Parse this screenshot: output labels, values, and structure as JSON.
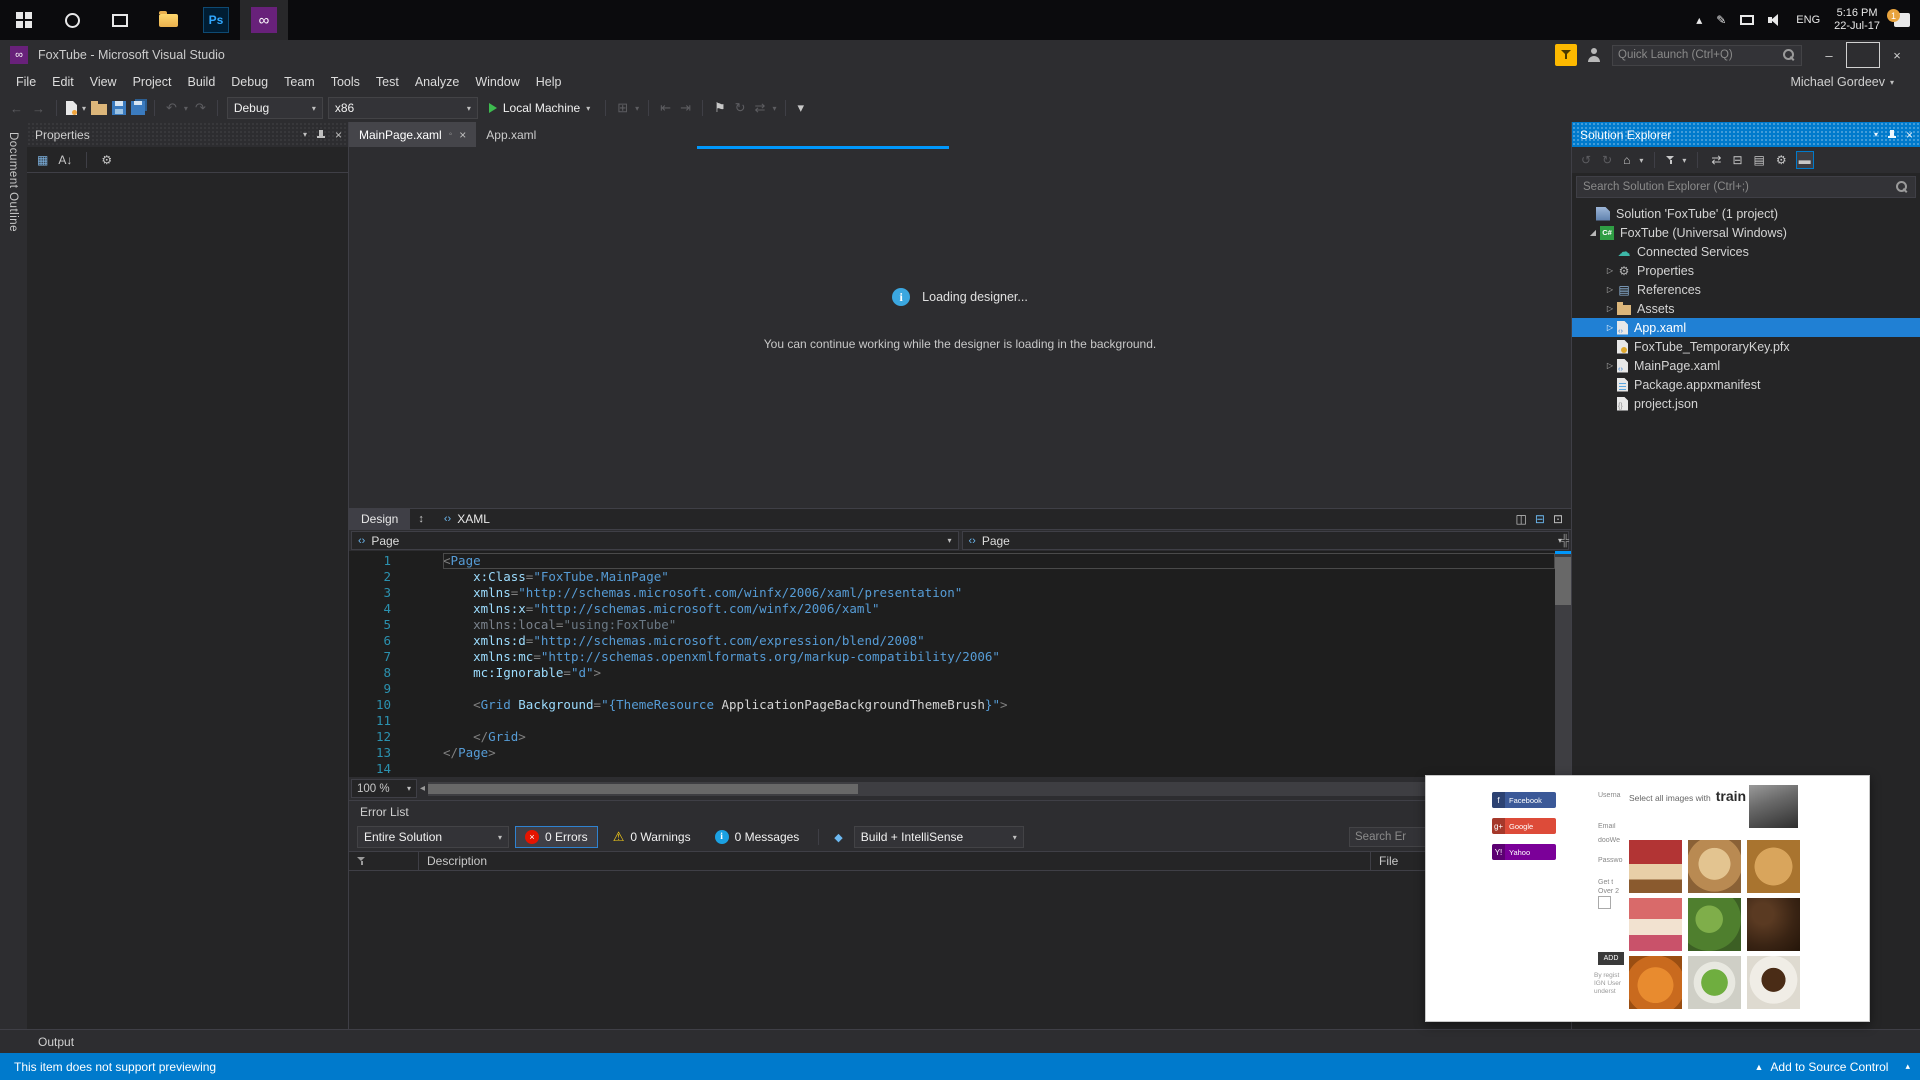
{
  "taskbar": {
    "tray": {
      "lang": "ENG",
      "time": "5:16 PM",
      "date": "22-Jul-17",
      "badge": "1"
    }
  },
  "titlebar": {
    "title": "FoxTube - Microsoft Visual Studio",
    "quick_launch_placeholder": "Quick Launch (Ctrl+Q)"
  },
  "menus": [
    "File",
    "Edit",
    "View",
    "Project",
    "Build",
    "Debug",
    "Team",
    "Tools",
    "Test",
    "Analyze",
    "Window",
    "Help"
  ],
  "account_name": "Michael Gordeev",
  "toolbar": {
    "configuration": "Debug",
    "platform": "x86",
    "run_target": "Local Machine"
  },
  "left_panel": {
    "autohide_tab": "Document Outline",
    "title": "Properties"
  },
  "editor": {
    "tabs": [
      {
        "label": "MainPage.xaml"
      },
      {
        "label": "App.xaml"
      }
    ],
    "designer_loading_title": "Loading designer...",
    "designer_loading_hint": "You can continue working while the designer is loading in the background.",
    "design_tab": "Design",
    "xaml_tab": "XAML",
    "breadcrumb_left": "Page",
    "breadcrumb_right": "Page",
    "zoom": "100 %",
    "code_lines": [
      [
        [
          "br",
          "<"
        ],
        [
          "tag",
          "Page"
        ]
      ],
      [
        [
          "pl",
          "    "
        ],
        [
          "att",
          "x:Class"
        ],
        [
          "br",
          "="
        ],
        [
          "val",
          "\"FoxTube.MainPage\""
        ]
      ],
      [
        [
          "pl",
          "    "
        ],
        [
          "att",
          "xmlns"
        ],
        [
          "br",
          "="
        ],
        [
          "val",
          "\"http://schemas.microsoft.com/winfx/2006/xaml/presentation\""
        ]
      ],
      [
        [
          "pl",
          "    "
        ],
        [
          "att",
          "xmlns:x"
        ],
        [
          "br",
          "="
        ],
        [
          "val",
          "\"http://schemas.microsoft.com/winfx/2006/xaml\""
        ]
      ],
      [
        [
          "pl",
          "    "
        ],
        [
          "dim",
          "xmlns:local"
        ],
        [
          "br",
          "="
        ],
        [
          "dmv",
          "\"using:FoxTube\""
        ]
      ],
      [
        [
          "pl",
          "    "
        ],
        [
          "att",
          "xmlns:d"
        ],
        [
          "br",
          "="
        ],
        [
          "val",
          "\"http://schemas.microsoft.com/expression/blend/2008\""
        ]
      ],
      [
        [
          "pl",
          "    "
        ],
        [
          "att",
          "xmlns:mc"
        ],
        [
          "br",
          "="
        ],
        [
          "val",
          "\"http://schemas.openxmlformats.org/markup-compatibility/2006\""
        ]
      ],
      [
        [
          "pl",
          "    "
        ],
        [
          "att",
          "mc:Ignorable"
        ],
        [
          "br",
          "="
        ],
        [
          "val",
          "\"d\""
        ],
        [
          "br",
          ">"
        ]
      ],
      [],
      [
        [
          "pl",
          "    "
        ],
        [
          "br",
          "<"
        ],
        [
          "tag",
          "Grid"
        ],
        [
          "pl",
          " "
        ],
        [
          "att",
          "Background"
        ],
        [
          "br",
          "="
        ],
        [
          "val",
          "\"{"
        ],
        [
          "tag",
          "ThemeResource"
        ],
        [
          "res",
          " ApplicationPageBackgroundThemeBrush"
        ],
        [
          "val",
          "}\""
        ],
        [
          "br",
          ">"
        ]
      ],
      [],
      [
        [
          "pl",
          "    "
        ],
        [
          "br",
          "</"
        ],
        [
          "tag",
          "Grid"
        ],
        [
          "br",
          ">"
        ]
      ],
      [
        [
          "br",
          "</"
        ],
        [
          "tag",
          "Page"
        ],
        [
          "br",
          ">"
        ]
      ],
      []
    ]
  },
  "error_list": {
    "title": "Error List",
    "scope": "Entire Solution",
    "errors_label": "0 Errors",
    "warnings_label": "0 Warnings",
    "messages_label": "0 Messages",
    "filter_label": "Build + IntelliSense",
    "search_placeholder": "Search Er",
    "columns": {
      "description": "Description",
      "file": "File"
    }
  },
  "output": {
    "title": "Output"
  },
  "statusbar": {
    "message": "This item does not support previewing",
    "source_control": "Add to Source Control"
  },
  "solution_explorer": {
    "title": "Solution Explorer",
    "search_placeholder": "Search Solution Explorer (Ctrl+;)",
    "items": [
      {
        "label": "Solution 'FoxTube' (1 project)",
        "icon": "solution",
        "indent": 0,
        "expander": ""
      },
      {
        "label": "FoxTube (Universal Windows)",
        "icon": "csproj",
        "indent": 1,
        "expander": "expanded"
      },
      {
        "label": "Connected Services",
        "icon": "services",
        "indent": 2,
        "expander": ""
      },
      {
        "label": "Properties",
        "icon": "properties",
        "indent": 2,
        "expander": "collapsed"
      },
      {
        "label": "References",
        "icon": "references",
        "indent": 2,
        "expander": "collapsed"
      },
      {
        "label": "Assets",
        "icon": "folder",
        "indent": 2,
        "expander": "collapsed"
      },
      {
        "label": "App.xaml",
        "icon": "xaml",
        "indent": 2,
        "expander": "collapsed",
        "selected": true
      },
      {
        "label": "FoxTube_TemporaryKey.pfx",
        "icon": "cert",
        "indent": 2,
        "expander": ""
      },
      {
        "label": "MainPage.xaml",
        "icon": "xaml",
        "indent": 2,
        "expander": "collapsed"
      },
      {
        "label": "Package.appxmanifest",
        "icon": "manifest",
        "indent": 2,
        "expander": ""
      },
      {
        "label": "project.json",
        "icon": "json",
        "indent": 2,
        "expander": ""
      }
    ]
  },
  "overlay": {
    "social_buttons": [
      {
        "name": "facebook",
        "label": "Facebook",
        "abbr": "f",
        "color": "#3b5998"
      },
      {
        "name": "google",
        "label": "Google",
        "abbr": "g+",
        "color": "#dd4b39"
      },
      {
        "name": "yahoo",
        "label": "Yahoo",
        "abbr": "Y!",
        "color": "#7b0099"
      }
    ],
    "form_fragments": [
      "Userna",
      "Email",
      "dooWe",
      "Passwo",
      "Get t",
      "Over 2"
    ],
    "add_button": "ADD",
    "fine_print": "By regist IGN User underst",
    "captcha": {
      "instruction": "Select all images with",
      "target": "train",
      "grid": [
        "strawberry-cake",
        "bread-bowl",
        "baked-pie",
        "dessert-cups",
        "green-salad",
        "coffee-beans",
        "citrus-fruit",
        "salad-plate",
        "coffee-cup"
      ]
    }
  },
  "colors": {
    "accent": "#007acc",
    "selection": "#2080d4",
    "statusbar": "#007acc"
  }
}
